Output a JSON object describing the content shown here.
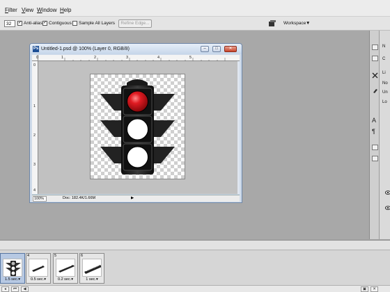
{
  "menu": {
    "items": [
      {
        "prefix": "",
        "underline": "F",
        "rest": "ilter"
      },
      {
        "prefix": "",
        "underline": "V",
        "rest": "iew"
      },
      {
        "prefix": "",
        "underline": "W",
        "rest": "indow"
      },
      {
        "prefix": "",
        "underline": "H",
        "rest": "elp"
      }
    ]
  },
  "options": {
    "value_field": "32",
    "anti_alias_label": "Anti-alias",
    "anti_alias_checked": true,
    "contiguous_label": "Contiguous",
    "contiguous_checked": true,
    "sample_all_layers_label": "Sample All Layers",
    "sample_all_layers_checked": false,
    "refine_edge_label": "Refine Edge...",
    "workspace_label": "Workspace",
    "dropdown_arrow": "▼",
    "workspace_icon": "workspace-icon"
  },
  "dock": {
    "labels": [
      "N",
      "C",
      "Li",
      "No",
      "Un",
      "Lo"
    ],
    "icons": [
      "tools-icon",
      "brush-icon",
      "text-icon",
      "paragraph-icon",
      "eye-icon"
    ]
  },
  "document": {
    "title": "Untitled-1.psd @ 100% (Layer 0, RGB/8)",
    "ps_badge": "Ps",
    "h_ruler_labels": [
      "0",
      "1",
      "2",
      "3",
      "4",
      "5"
    ],
    "v_ruler_labels": [
      "0",
      "1",
      "2",
      "3",
      "4"
    ],
    "zoom": "100%",
    "doc_info": "Doc: 182.4K/1.66M",
    "arrow": "▶",
    "window_buttons": {
      "minimize": "–",
      "maximize": "□",
      "close": "✕"
    },
    "content": "traffic-light-image",
    "lamp_colors": [
      "#c4141a",
      "#ffffff",
      "#ffffff"
    ]
  },
  "animation": {
    "frames": [
      {
        "number": "",
        "delay": "1.5 sec.",
        "selected": true,
        "thumb": "traffic-light"
      },
      {
        "number": "4",
        "delay": "0.5 sec.",
        "selected": false,
        "thumb": "text-strip"
      },
      {
        "number": "5",
        "delay": "0.2 sec.",
        "selected": false,
        "thumb": "text-strip"
      },
      {
        "number": "6",
        "delay": "1 sec.",
        "selected": false,
        "thumb": "text-strip"
      }
    ],
    "dropdown_arrow": "▾"
  }
}
